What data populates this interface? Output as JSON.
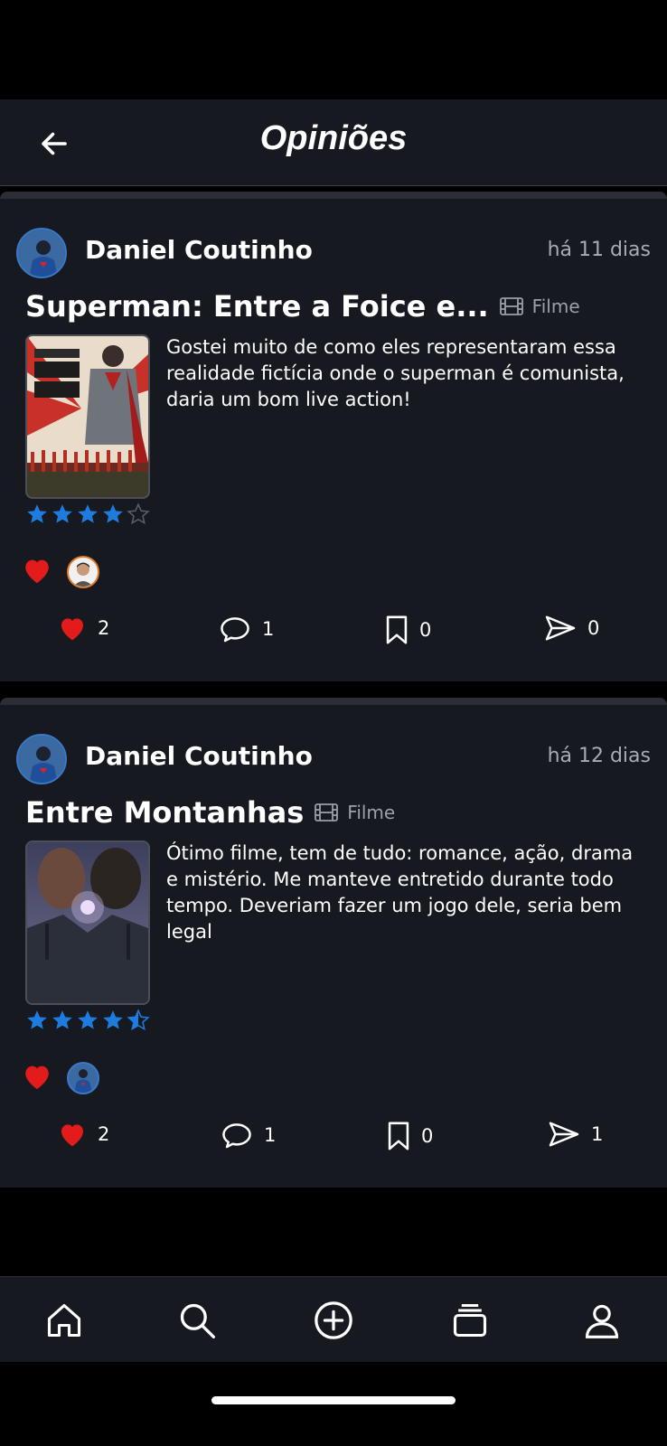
{
  "header": {
    "title": "Opiniões",
    "back_icon": "arrow-left-icon"
  },
  "colors": {
    "background": "#000000",
    "card": "#161a20",
    "heart": "#e41b1b",
    "star": "#1e7be0",
    "muted": "#a7abb2"
  },
  "posts": [
    {
      "user": "Daniel Coutinho",
      "time_ago": "há 11 dias",
      "title": "Superman: Entre a Foice e...",
      "media_type": "Filme",
      "review": "Gostei muito de como eles representaram essa realidade fictícia onde o superman é comunista, daria um bom live action!",
      "rating": 4,
      "rating_max": 5,
      "likes": "2",
      "comments": "1",
      "saves": "0",
      "shares": "0"
    },
    {
      "user": "Daniel Coutinho",
      "time_ago": "há 12 dias",
      "title": "Entre Montanhas",
      "media_type": "Filme",
      "review": "Ótimo filme, tem de tudo: romance, ação, drama e mistério. Me manteve entretido durante todo tempo. Deveriam fazer um jogo dele, seria bem legal",
      "rating": 4.5,
      "rating_max": 5,
      "likes": "2",
      "comments": "1",
      "saves": "0",
      "shares": "1"
    }
  ],
  "nav": [
    "home-icon",
    "search-icon",
    "add-circle-icon",
    "collections-icon",
    "profile-icon"
  ]
}
